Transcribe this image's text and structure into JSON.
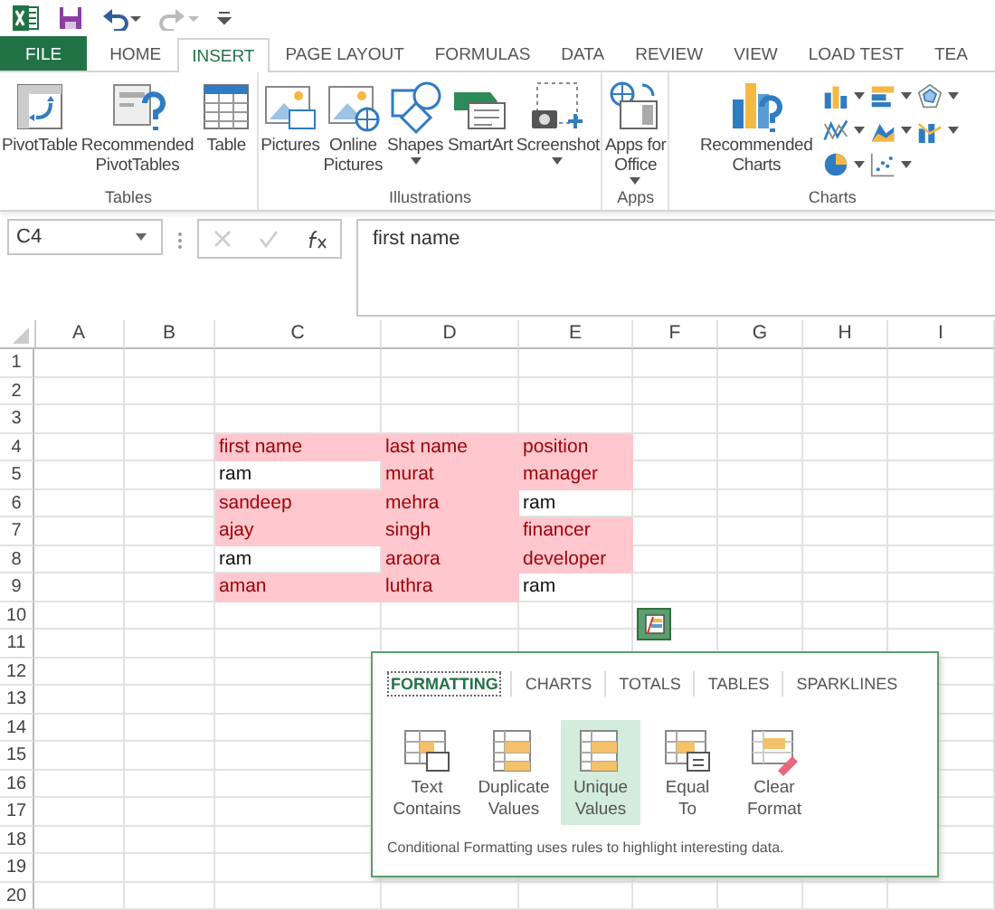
{
  "tabs": [
    {
      "label": "FILE",
      "kind": "file",
      "selected": false
    },
    {
      "label": "HOME",
      "kind": "tab",
      "selected": false
    },
    {
      "label": "INSERT",
      "kind": "tab",
      "selected": true
    },
    {
      "label": "PAGE LAYOUT",
      "kind": "tab",
      "selected": false
    },
    {
      "label": "FORMULAS",
      "kind": "tab",
      "selected": false
    },
    {
      "label": "DATA",
      "kind": "tab",
      "selected": false
    },
    {
      "label": "REVIEW",
      "kind": "tab",
      "selected": false
    },
    {
      "label": "VIEW",
      "kind": "tab",
      "selected": false
    },
    {
      "label": "LOAD TEST",
      "kind": "tab",
      "selected": false
    },
    {
      "label": "TEA",
      "kind": "tab",
      "selected": false
    }
  ],
  "ribbon": {
    "groups": [
      {
        "name": "Tables",
        "buttons": [
          {
            "label": "PivotTable",
            "dropdown": false
          },
          {
            "label": "Recommended\nPivotTables",
            "dropdown": false
          },
          {
            "label": "Table",
            "dropdown": false
          }
        ]
      },
      {
        "name": "Illustrations",
        "buttons": [
          {
            "label": "Pictures",
            "dropdown": false
          },
          {
            "label": "Online\nPictures",
            "dropdown": false
          },
          {
            "label": "Shapes",
            "dropdown": true
          },
          {
            "label": "SmartArt",
            "dropdown": false
          },
          {
            "label": "Screenshot",
            "dropdown": true
          }
        ]
      },
      {
        "name": "Apps",
        "buttons": [
          {
            "label": "Apps for\nOffice",
            "dropdown": true
          }
        ]
      },
      {
        "name": "Charts",
        "buttons": [
          {
            "label": "Recommended\nCharts",
            "dropdown": false
          }
        ]
      }
    ]
  },
  "formula_bar": {
    "name_box": "C4",
    "formula": "first name"
  },
  "sheet": {
    "columns": [
      "A",
      "B",
      "C",
      "D",
      "E",
      "F",
      "G",
      "H",
      "I"
    ],
    "rows": [
      {
        "header": "1"
      },
      {
        "header": "2"
      },
      {
        "header": "3"
      },
      {
        "header": "4",
        "cells": [
          {
            "text": "first name",
            "highlighted": true
          },
          {
            "text": "last name",
            "highlighted": true
          },
          {
            "text": "position",
            "highlighted": true
          }
        ]
      },
      {
        "header": "5",
        "cells": [
          {
            "text": "ram",
            "highlighted": false
          },
          {
            "text": "murat",
            "highlighted": true
          },
          {
            "text": "manager",
            "highlighted": true
          }
        ]
      },
      {
        "header": "6",
        "cells": [
          {
            "text": "sandeep",
            "highlighted": true
          },
          {
            "text": "mehra",
            "highlighted": true
          },
          {
            "text": "ram",
            "highlighted": false
          }
        ]
      },
      {
        "header": "7",
        "cells": [
          {
            "text": "ajay",
            "highlighted": true
          },
          {
            "text": "singh",
            "highlighted": true
          },
          {
            "text": "financer",
            "highlighted": true
          }
        ]
      },
      {
        "header": "8",
        "cells": [
          {
            "text": "ram",
            "highlighted": false
          },
          {
            "text": "araora",
            "highlighted": true
          },
          {
            "text": "developer",
            "highlighted": true
          }
        ]
      },
      {
        "header": "9",
        "cells": [
          {
            "text": "aman",
            "highlighted": true
          },
          {
            "text": "luthra",
            "highlighted": true
          },
          {
            "text": "ram",
            "highlighted": false
          }
        ]
      },
      {
        "header": "10"
      },
      {
        "header": "11"
      },
      {
        "header": "12"
      },
      {
        "header": "13"
      },
      {
        "header": "14"
      },
      {
        "header": "15"
      },
      {
        "header": "16"
      },
      {
        "header": "17"
      },
      {
        "header": "18"
      },
      {
        "header": "19"
      },
      {
        "header": "20"
      }
    ]
  },
  "quick_analysis": {
    "tabs": [
      {
        "label": "FORMATTING",
        "selected": true
      },
      {
        "label": "CHARTS",
        "selected": false
      },
      {
        "label": "TOTALS",
        "selected": false
      },
      {
        "label": "TABLES",
        "selected": false
      },
      {
        "label": "SPARKLINES",
        "selected": false
      }
    ],
    "options": [
      {
        "label": "Text\nContains",
        "selected": false
      },
      {
        "label": "Duplicate\nValues",
        "selected": false
      },
      {
        "label": "Unique\nValues",
        "selected": true
      },
      {
        "label": "Equal\nTo",
        "selected": false
      },
      {
        "label": "Clear\nFormat",
        "selected": false
      }
    ],
    "description": "Conditional Formatting uses rules to highlight interesting data."
  }
}
